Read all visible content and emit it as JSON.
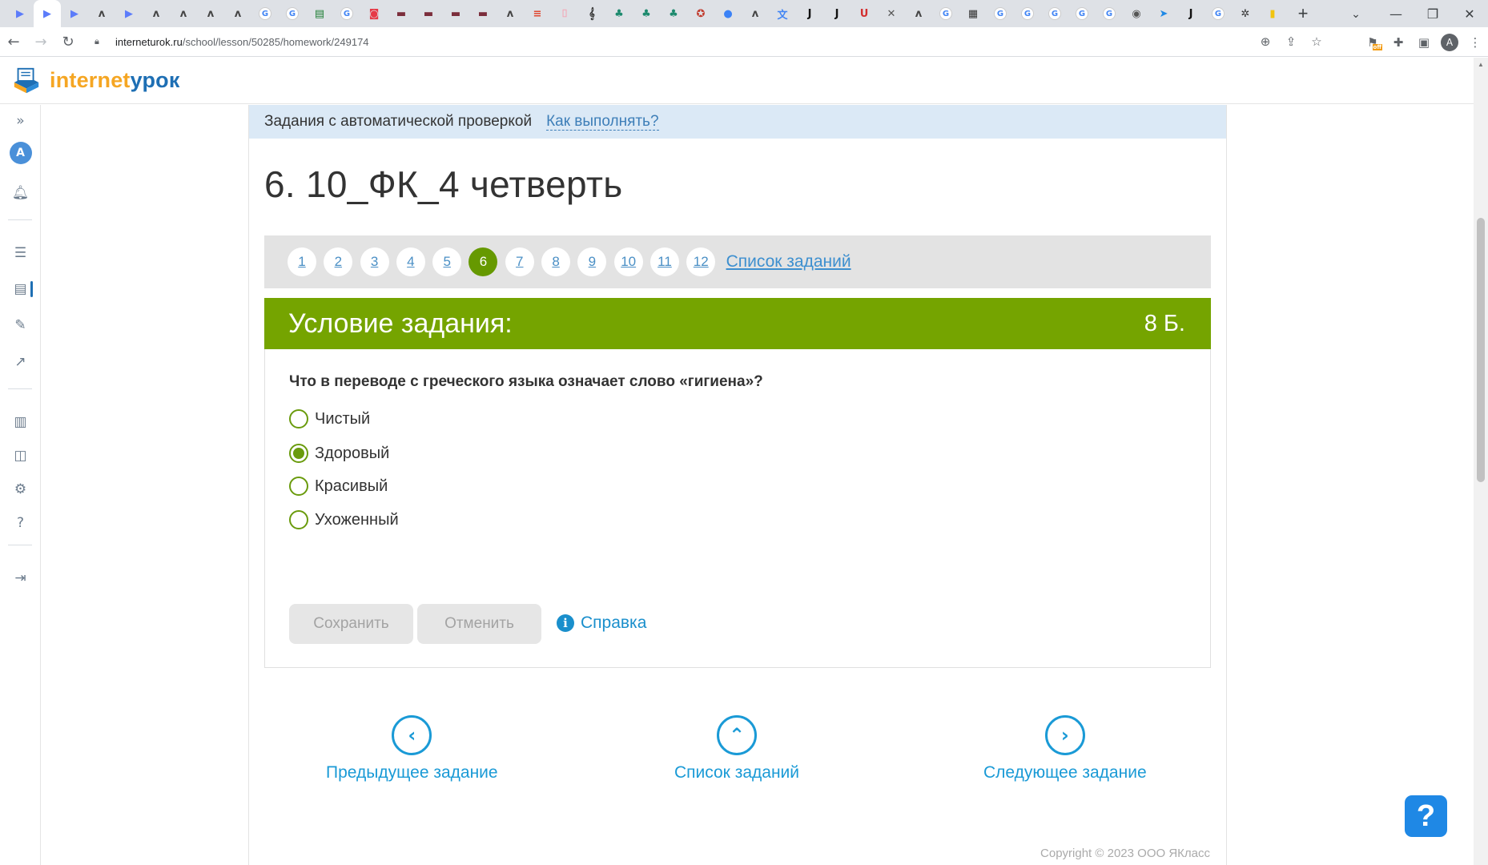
{
  "browser": {
    "tabs": [
      {
        "icon": "play-icon",
        "color": "#5c7cfa",
        "glyph": "▶"
      },
      {
        "icon": "play-icon",
        "color": "#5c7cfa",
        "glyph": "▶",
        "active": true
      },
      {
        "icon": "play-icon",
        "color": "#5c7cfa",
        "glyph": "▶"
      },
      {
        "icon": "a-icon",
        "color": "#444",
        "glyph": "ᴧ"
      },
      {
        "icon": "play-icon",
        "color": "#5c7cfa",
        "glyph": "▶"
      },
      {
        "icon": "a-icon",
        "color": "#444",
        "glyph": "ᴧ"
      },
      {
        "icon": "a-icon",
        "color": "#444",
        "glyph": "ᴧ"
      },
      {
        "icon": "a-icon",
        "color": "#444",
        "glyph": "ᴧ"
      },
      {
        "icon": "a-icon",
        "color": "#444",
        "glyph": "ᴧ"
      },
      {
        "icon": "google-icon",
        "color": "#fff",
        "glyph": "G"
      },
      {
        "icon": "google-icon",
        "color": "#fff",
        "glyph": "G"
      },
      {
        "icon": "sheet-icon",
        "color": "#1e7e34",
        "glyph": "▤"
      },
      {
        "icon": "google-icon",
        "color": "#fff",
        "glyph": "G"
      },
      {
        "icon": "red-icon",
        "color": "#e63946",
        "glyph": "◙"
      },
      {
        "icon": "book-icon",
        "color": "#7b2d3b",
        "glyph": "▬"
      },
      {
        "icon": "book-icon",
        "color": "#7b2d3b",
        "glyph": "▬"
      },
      {
        "icon": "book-icon",
        "color": "#7b2d3b",
        "glyph": "▬"
      },
      {
        "icon": "book-icon",
        "color": "#7b2d3b",
        "glyph": "▬"
      },
      {
        "icon": "a-icon",
        "color": "#444",
        "glyph": "ᴧ"
      },
      {
        "icon": "list-icon",
        "color": "#e0462e",
        "glyph": "≡"
      },
      {
        "icon": "doc-icon",
        "color": "#f4a6b5",
        "glyph": "⌷"
      },
      {
        "icon": "music-icon",
        "color": "#333",
        "glyph": "𝄞"
      },
      {
        "icon": "leaf-icon",
        "color": "#1d8a6e",
        "glyph": "♣"
      },
      {
        "icon": "leaf-icon",
        "color": "#1d8a6e",
        "glyph": "♣"
      },
      {
        "icon": "leaf-icon",
        "color": "#1d8a6e",
        "glyph": "♣"
      },
      {
        "icon": "red-app-icon",
        "color": "#c0392b",
        "glyph": "✪"
      },
      {
        "icon": "drop-icon",
        "color": "#3b82f6",
        "glyph": "●"
      },
      {
        "icon": "a-icon",
        "color": "#444",
        "glyph": "ᴧ"
      },
      {
        "icon": "translate-icon",
        "color": "#4285f4",
        "glyph": "文"
      },
      {
        "icon": "j-icon",
        "color": "#111",
        "glyph": "J"
      },
      {
        "icon": "j-icon",
        "color": "#111",
        "glyph": "J"
      },
      {
        "icon": "u-icon",
        "color": "#d32f2f",
        "glyph": "U"
      },
      {
        "icon": "x-icon",
        "color": "#555",
        "glyph": "✕"
      },
      {
        "icon": "a-icon",
        "color": "#444",
        "glyph": "ᴧ"
      },
      {
        "icon": "google-icon",
        "color": "#fff",
        "glyph": "G"
      },
      {
        "icon": "film-icon",
        "color": "#333",
        "glyph": "▦"
      },
      {
        "icon": "google-icon",
        "color": "#fff",
        "glyph": "G"
      },
      {
        "icon": "google-icon",
        "color": "#fff",
        "glyph": "G"
      },
      {
        "icon": "google-icon",
        "color": "#fff",
        "glyph": "G"
      },
      {
        "icon": "google-icon",
        "color": "#fff",
        "glyph": "G"
      },
      {
        "icon": "google-icon",
        "color": "#fff",
        "glyph": "G"
      },
      {
        "icon": "chrome-icon",
        "color": "#555",
        "glyph": "◉"
      },
      {
        "icon": "bird-icon",
        "color": "#1e88e5",
        "glyph": "➤"
      },
      {
        "icon": "j-icon",
        "color": "#111",
        "glyph": "J"
      },
      {
        "icon": "google-icon",
        "color": "#fff",
        "glyph": "G"
      },
      {
        "icon": "gear-icon",
        "color": "#333",
        "glyph": "✲"
      },
      {
        "icon": "note-icon",
        "color": "#f1c40f",
        "glyph": "▮"
      }
    ],
    "url_host": "interneturok.ru",
    "url_path": "/school/lesson/50285/homework/249174",
    "profile_initial": "A",
    "extension_badge": "off"
  },
  "site": {
    "logo_part1": "internet",
    "logo_part2": "урок"
  },
  "rail": {
    "avatar_letter": "A"
  },
  "banner": {
    "label": "Задания с автоматической проверкой",
    "howto": "Как выполнять?"
  },
  "lesson": {
    "title": "6. 10_ФК_4 четверть"
  },
  "task_nav": {
    "numbers": [
      "1",
      "2",
      "3",
      "4",
      "5",
      "6",
      "7",
      "8",
      "9",
      "10",
      "11",
      "12"
    ],
    "active": "6",
    "list_link": "Список заданий"
  },
  "condition": {
    "title": "Условие задания:",
    "points": "8 Б.",
    "question": "Что в переводе с греческого языка означает слово «гигиена»?",
    "options": [
      {
        "label": "Чистый",
        "selected": false
      },
      {
        "label": "Здоровый",
        "selected": true
      },
      {
        "label": "Красивый",
        "selected": false
      },
      {
        "label": "Ухоженный",
        "selected": false
      }
    ],
    "save_label": "Сохранить",
    "cancel_label": "Отменить",
    "help_label": "Справка"
  },
  "bottom_nav": {
    "prev_label": "Предыдущее задание",
    "list_label": "Список заданий",
    "next_label": "Следующее задание"
  },
  "footer": {
    "copyright": "Copyright © 2023 ООО ЯКласс"
  },
  "colors": {
    "accent_green": "#75a400",
    "link_blue": "#1a9ad6",
    "banner_bg": "#dbe9f6"
  }
}
